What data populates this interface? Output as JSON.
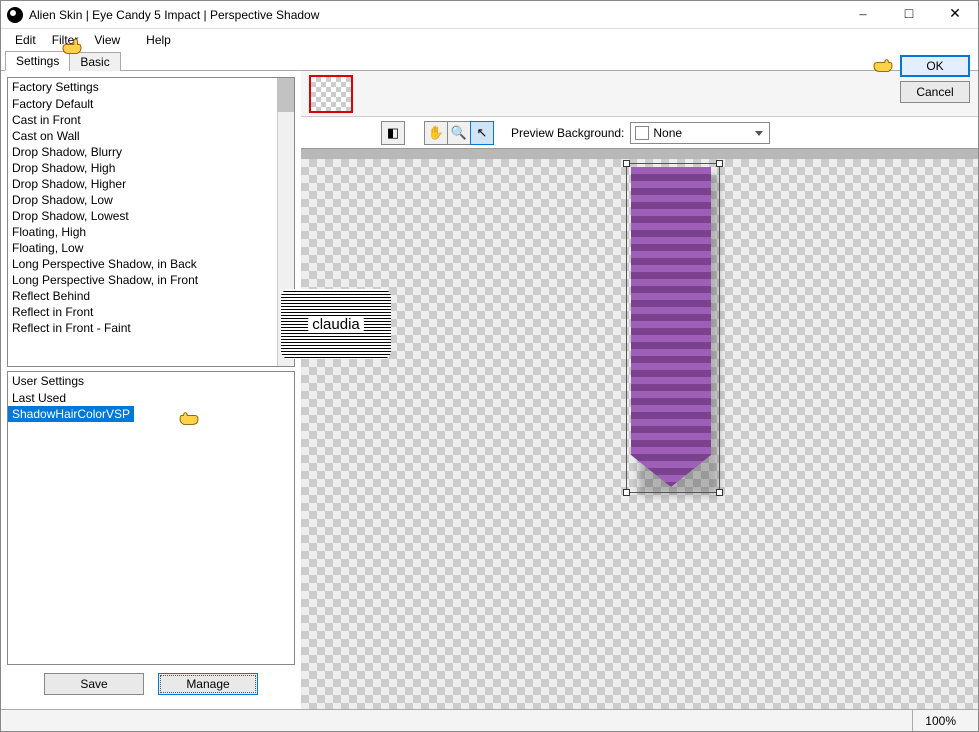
{
  "window": {
    "title": "Alien Skin | Eye Candy 5 Impact | Perspective Shadow"
  },
  "menu": {
    "edit": "Edit",
    "filter": "Filter",
    "view": "View",
    "help": "Help"
  },
  "tabs": {
    "settings": "Settings",
    "basic": "Basic"
  },
  "factory": {
    "header": "Factory Settings",
    "items": [
      "Factory Default",
      "Cast in Front",
      "Cast on Wall",
      "Drop Shadow, Blurry",
      "Drop Shadow, High",
      "Drop Shadow, Higher",
      "Drop Shadow, Low",
      "Drop Shadow, Lowest",
      "Floating, High",
      "Floating, Low",
      "Long Perspective Shadow, in Back",
      "Long Perspective Shadow, in Front",
      "Reflect Behind",
      "Reflect in Front",
      "Reflect in Front - Faint"
    ]
  },
  "user": {
    "header": "User Settings",
    "items": [
      "Last Used",
      "ShadowHairColorVSP"
    ],
    "selected_index": 1
  },
  "buttons": {
    "save": "Save",
    "manage": "Manage",
    "ok": "OK",
    "cancel": "Cancel"
  },
  "preview": {
    "bg_label": "Preview Background:",
    "bg_value": "None"
  },
  "status": {
    "zoom": "100%"
  },
  "watermark": "claudia"
}
